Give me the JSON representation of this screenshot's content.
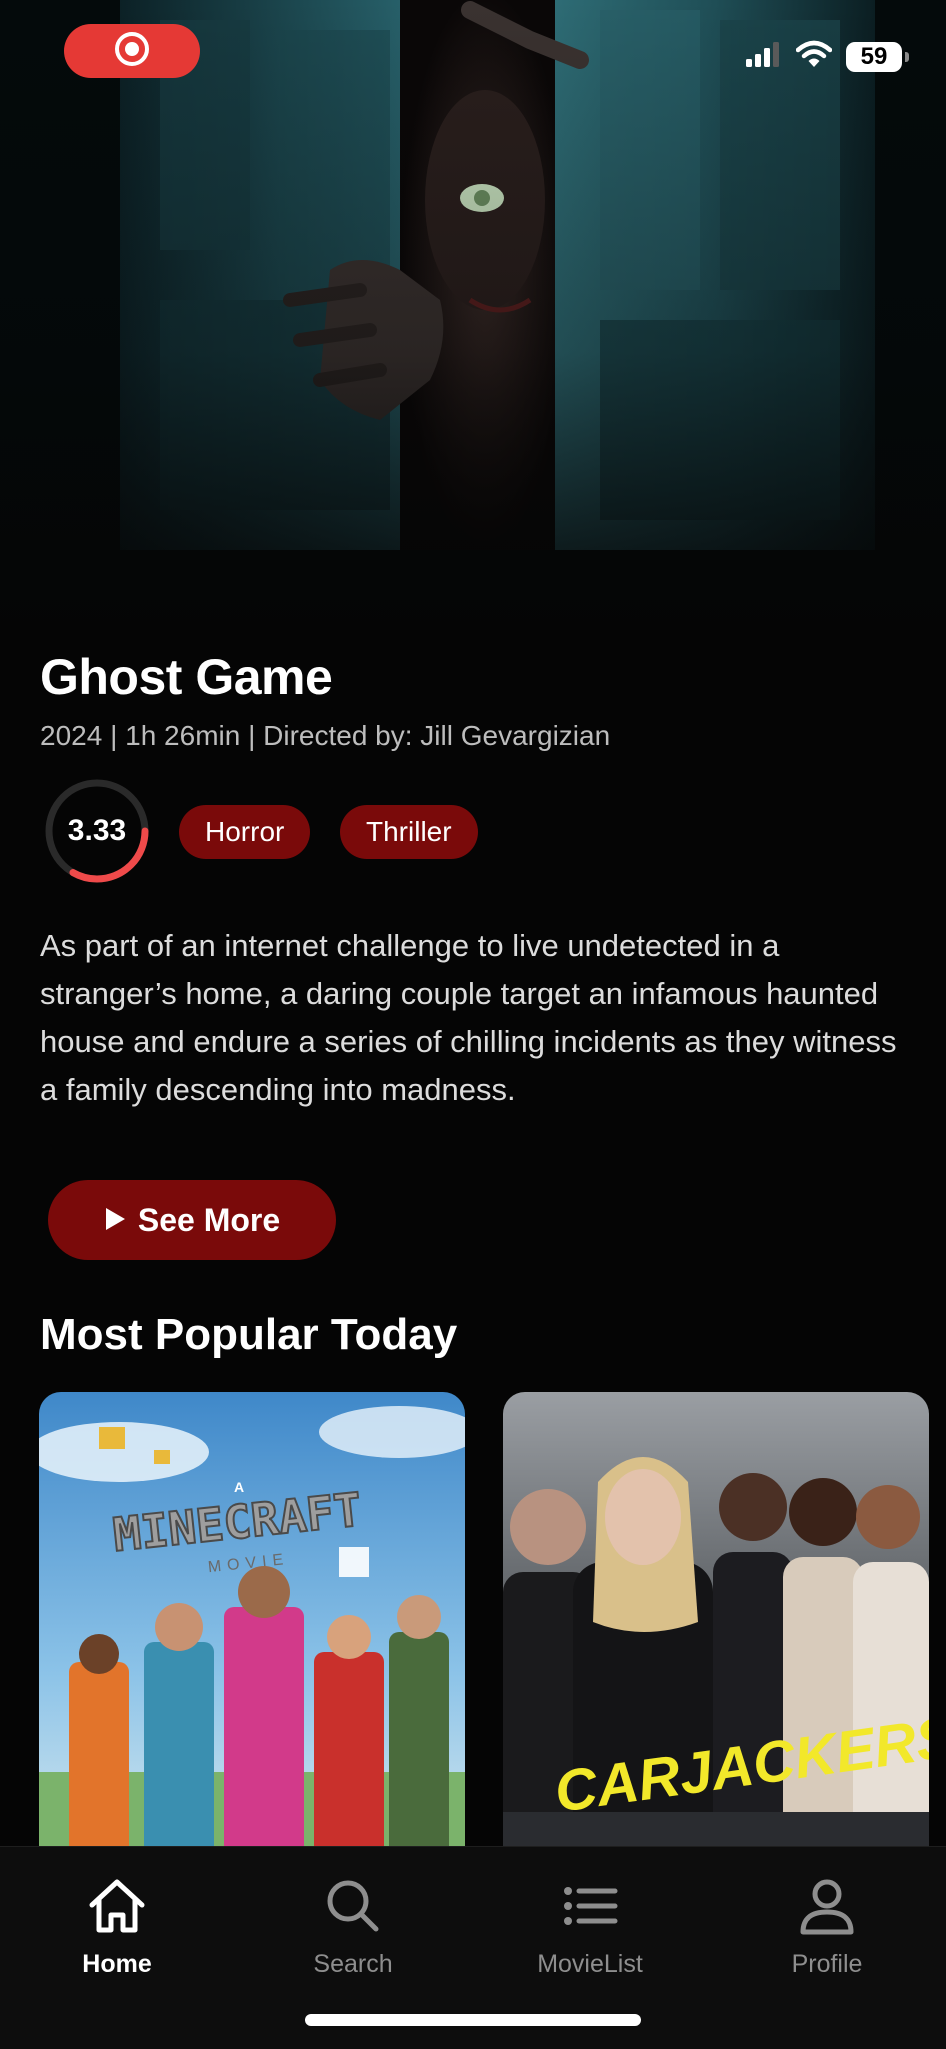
{
  "status_bar": {
    "battery": "59",
    "recording_icon": "record-icon",
    "signal_icon": "cellular-signal-icon",
    "wifi_icon": "wifi-icon"
  },
  "hero": {
    "image": "ghost-game-backdrop"
  },
  "movie": {
    "title": "Ghost Game",
    "meta": "2024 | 1h 26min | Directed by: Jill Gevargizian",
    "rating": "3.33",
    "rating_fraction": 0.333,
    "genres": [
      "Horror",
      "Thriller"
    ],
    "description": "As part of an internet challenge to live undetected in a stranger’s home, a daring couple target an infamous haunted house and endure a series of chilling incidents as they witness a family descending into madness."
  },
  "actions": {
    "see_more_label": "See More",
    "play_icon": "play-icon"
  },
  "popular": {
    "section_title": "Most Popular Today",
    "posters": [
      {
        "logo": "A",
        "title": "MINECRAFT",
        "subtitle": "MOVIE"
      },
      {
        "title": "CARJACKERS"
      }
    ]
  },
  "tab_bar": {
    "tabs": [
      {
        "label": "Home",
        "icon": "home-icon",
        "active": true
      },
      {
        "label": "Search",
        "icon": "search-icon",
        "active": false
      },
      {
        "label": "MovieList",
        "icon": "list-icon",
        "active": false
      },
      {
        "label": "Profile",
        "icon": "profile-icon",
        "active": false
      }
    ]
  },
  "colors": {
    "accent": "#e53935",
    "chip_bg": "#7a0a0a",
    "background": "#050505"
  }
}
